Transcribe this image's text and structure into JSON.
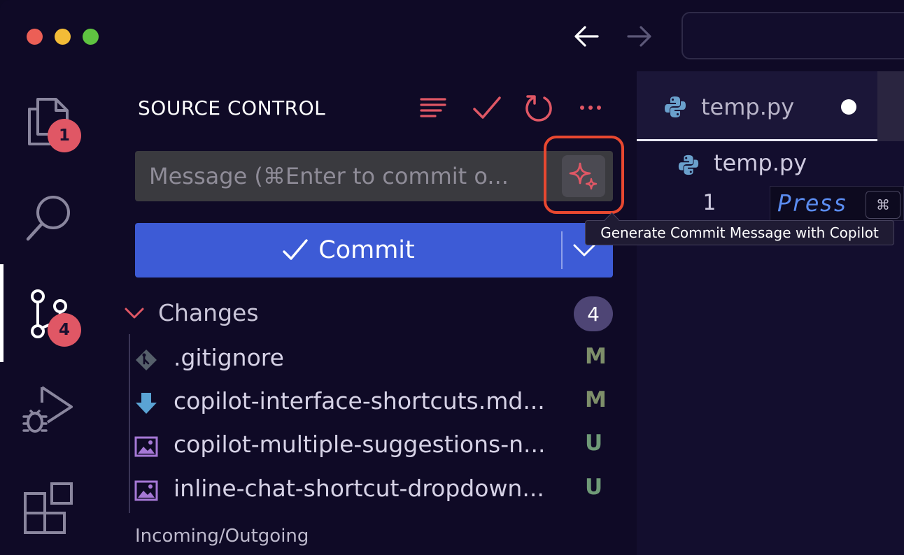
{
  "window": {
    "controls": [
      "close",
      "minimize",
      "zoom"
    ]
  },
  "titlebar": {
    "back_icon": "arrow-left-icon",
    "forward_icon": "arrow-right-icon"
  },
  "activity_bar": {
    "items": [
      {
        "name": "explorer",
        "icon": "files-icon",
        "badge": "1"
      },
      {
        "name": "search",
        "icon": "search-icon"
      },
      {
        "name": "source-control",
        "icon": "source-control-icon",
        "badge": "4",
        "active": true
      },
      {
        "name": "run-debug",
        "icon": "run-debug-icon"
      },
      {
        "name": "extensions",
        "icon": "extensions-icon"
      }
    ]
  },
  "source_control": {
    "title": "SOURCE CONTROL",
    "actions": [
      "view-as-tree-icon",
      "commit-check-icon",
      "refresh-icon",
      "more-icon"
    ],
    "message_placeholder": "Message (⌘Enter to commit o...",
    "sparkle_icon": "sparkle-icon",
    "commit_label": "Commit",
    "changes_label": "Changes",
    "changes_count": "4",
    "files": [
      {
        "name": ".gitignore",
        "status": "M",
        "icon": "git-file-icon"
      },
      {
        "name": "copilot-interface-shortcuts.md...",
        "status": "M",
        "icon": "markdown-download-icon"
      },
      {
        "name": "copilot-multiple-suggestions-n...",
        "status": "U",
        "icon": "image-file-icon"
      },
      {
        "name": "inline-chat-shortcut-dropdown...",
        "status": "U",
        "icon": "image-file-icon"
      }
    ],
    "incoming_outgoing_label": "Incoming/Outgoing"
  },
  "tooltip": {
    "text": "Generate Commit Message with Copilot"
  },
  "editor": {
    "tab_label": "temp.py",
    "breadcrumb_label": "temp.py",
    "line_number": "1",
    "ghost_text": "Press",
    "kbd": "⌘"
  },
  "colors": {
    "background": "#0f0a26",
    "accent_red": "#e05765",
    "commit_blue": "#3d5bd6",
    "highlight_ring": "#e84830"
  }
}
